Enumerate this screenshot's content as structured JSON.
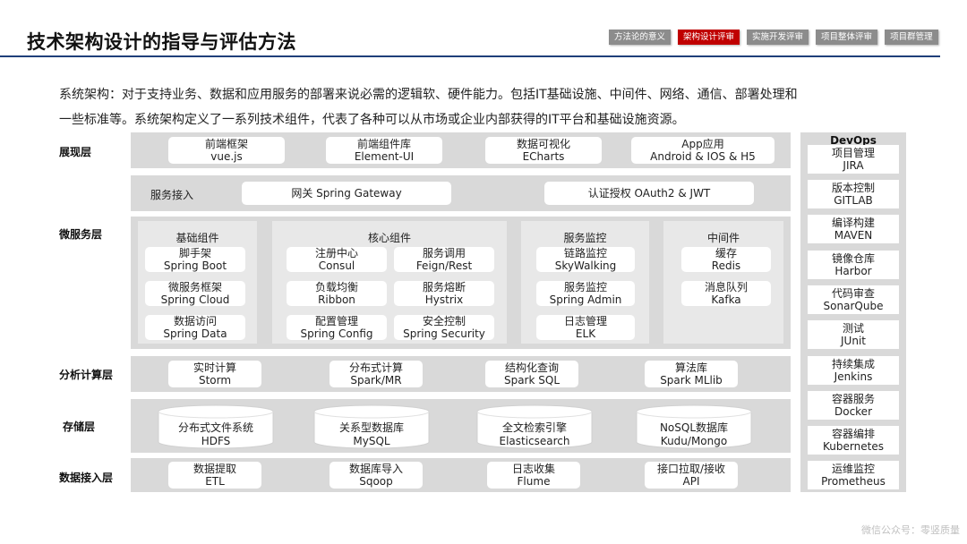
{
  "header": {
    "title": "技术架构设计的指导与评估方法",
    "tabs": [
      {
        "label": "方法论的意义",
        "active": false
      },
      {
        "label": "架构设计评审",
        "active": true
      },
      {
        "label": "实施开发评审",
        "active": false
      },
      {
        "label": "项目整体评审",
        "active": false
      },
      {
        "label": "项目群管理",
        "active": false
      }
    ],
    "accent_color": "#c00000",
    "line_color": "#1f3f7a"
  },
  "intro": {
    "line1": "系统架构：对于支持业务、数据和应用服务的部署来说必需的逻辑软、硬件能力。包括IT基础设施、中间件、网络、通信、部署处理和",
    "line2": "一些标准等。系统架构定义了一系列技术组件，代表了各种可以从市场或企业内部获得的IT平台和基础设施资源。"
  },
  "layers": {
    "presentation": {
      "label": "展现层",
      "items": [
        {
          "l1": "前端框架",
          "l2": "vue.js"
        },
        {
          "l1": "前端组件库",
          "l2": "Element-UI"
        },
        {
          "l1": "数据可视化",
          "l2": "ECharts"
        },
        {
          "l1": "App应用",
          "l2": "Android & IOS & H5"
        }
      ]
    },
    "gateway": {
      "label": "服务接入",
      "items": [
        "网关 Spring Gateway",
        "认证授权 OAuth2 & JWT"
      ]
    },
    "microservice": {
      "label": "微服务层",
      "groups": [
        {
          "caption": "基础组件",
          "items": [
            {
              "l1": "脚手架",
              "l2": "Spring Boot"
            },
            {
              "l1": "微服务框架",
              "l2": "Spring Cloud"
            },
            {
              "l1": "数据访问",
              "l2": "Spring Data"
            }
          ]
        },
        {
          "caption": "核心组件",
          "items": [
            {
              "l1": "注册中心",
              "l2": "Consul"
            },
            {
              "l1": "服务调用",
              "l2": "Feign/Rest"
            },
            {
              "l1": "负载均衡",
              "l2": "Ribbon"
            },
            {
              "l1": "服务熔断",
              "l2": "Hystrix"
            },
            {
              "l1": "配置管理",
              "l2": "Spring Config"
            },
            {
              "l1": "安全控制",
              "l2": "Spring Security"
            }
          ]
        },
        {
          "caption": "服务监控",
          "items": [
            {
              "l1": "链路监控",
              "l2": "SkyWalking"
            },
            {
              "l1": "服务监控",
              "l2": "Spring Admin"
            },
            {
              "l1": "日志管理",
              "l2": "ELK"
            }
          ]
        },
        {
          "caption": "中间件",
          "items": [
            {
              "l1": "缓存",
              "l2": "Redis"
            },
            {
              "l1": "消息队列",
              "l2": "Kafka"
            }
          ]
        }
      ]
    },
    "analytics": {
      "label": "分析计算层",
      "items": [
        {
          "l1": "实时计算",
          "l2": "Storm"
        },
        {
          "l1": "分布式计算",
          "l2": "Spark/MR"
        },
        {
          "l1": "结构化查询",
          "l2": "Spark SQL"
        },
        {
          "l1": "算法库",
          "l2": "Spark MLlib"
        }
      ]
    },
    "storage": {
      "label": "存储层",
      "items": [
        {
          "l1": "分布式文件系统",
          "l2": "HDFS"
        },
        {
          "l1": "关系型数据库",
          "l2": "MySQL"
        },
        {
          "l1": "全文检索引擎",
          "l2": "Elasticsearch"
        },
        {
          "l1": "NoSQL数据库",
          "l2": "Kudu/Mongo"
        }
      ]
    },
    "ingestion": {
      "label": "数据接入层",
      "items": [
        {
          "l1": "数据提取",
          "l2": "ETL"
        },
        {
          "l1": "数据库导入",
          "l2": "Sqoop"
        },
        {
          "l1": "日志收集",
          "l2": "Flume"
        },
        {
          "l1": "接口拉取/接收",
          "l2": "API"
        }
      ]
    }
  },
  "devops": {
    "title": "DevOps",
    "items": [
      {
        "l1": "项目管理",
        "l2": "JIRA"
      },
      {
        "l1": "版本控制",
        "l2": "GITLAB"
      },
      {
        "l1": "编译构建",
        "l2": "MAVEN"
      },
      {
        "l1": "镜像仓库",
        "l2": "Harbor"
      },
      {
        "l1": "代码审查",
        "l2": "SonarQube"
      },
      {
        "l1": "测试",
        "l2": "JUnit"
      },
      {
        "l1": "持续集成",
        "l2": "Jenkins"
      },
      {
        "l1": "容器服务",
        "l2": "Docker"
      },
      {
        "l1": "容器编排",
        "l2": "Kubernetes"
      },
      {
        "l1": "运维监控",
        "l2": "Prometheus"
      }
    ]
  },
  "watermark": "微信公众号：零竖质量"
}
